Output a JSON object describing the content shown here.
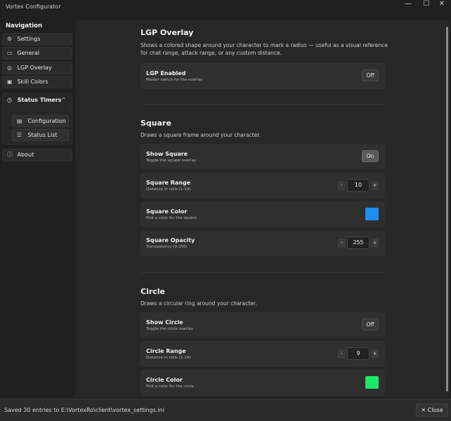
{
  "window": {
    "title": "Vortex Configurator",
    "minimize": "—",
    "maximize": "☐",
    "close": "✕"
  },
  "sidebar": {
    "heading": "Navigation",
    "items": [
      {
        "label": "Settings",
        "icon": "⚙"
      },
      {
        "label": "General",
        "icon": "▭"
      },
      {
        "label": "LGP Overlay",
        "icon": "◎"
      },
      {
        "label": "Skill Colors",
        "icon": "▣"
      }
    ],
    "group": {
      "label": "Status Timers",
      "icon": "◷",
      "chevron": "⌃",
      "items": [
        {
          "label": "Configuration",
          "icon": "▤"
        },
        {
          "label": "Status List",
          "icon": "☰"
        }
      ]
    },
    "about": {
      "label": "About",
      "icon": "ⓘ"
    }
  },
  "sections": {
    "lgp": {
      "title": "LGP Overlay",
      "desc": "Shows a colored shape around your character to mark a radius — useful as a visual reference for chat range, attack range, or any custom distance.",
      "enabled": {
        "title": "LGP Enabled",
        "sub": "Master switch for the overlay",
        "value": "Off"
      }
    },
    "square": {
      "title": "Square",
      "desc": "Draws a square frame around your character.",
      "show": {
        "title": "Show Square",
        "sub": "Toggle the square overlay",
        "value": "On"
      },
      "range": {
        "title": "Square Range",
        "sub": "Distance in cells (1-14)",
        "value": "10"
      },
      "color": {
        "title": "Square Color",
        "sub": "Pick a color for the square",
        "swatch": "#1f8ef1"
      },
      "opacity": {
        "title": "Square Opacity",
        "sub": "Transparency (0-255)",
        "value": "255"
      }
    },
    "circle": {
      "title": "Circle",
      "desc": "Draws a circular ring around your character.",
      "show": {
        "title": "Show Circle",
        "sub": "Toggle the circle overlay",
        "value": "Off"
      },
      "range": {
        "title": "Circle Range",
        "sub": "Distance in cells (1-14)",
        "value": "9"
      },
      "color": {
        "title": "Circle Color",
        "sub": "Pick a color for the circle",
        "swatch": "#1ee86a"
      }
    }
  },
  "stepper": {
    "minus": "-",
    "plus": "+"
  },
  "statusbar": {
    "message": "Saved 30 entries to E:\\VortexRo\\client\\vortex_settings.ini",
    "close_label": "✕  Close"
  }
}
